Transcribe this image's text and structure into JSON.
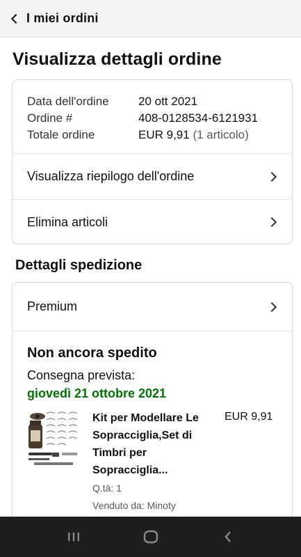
{
  "header": {
    "back_label": "I miei ordini"
  },
  "page_title": "Visualizza dettagli ordine",
  "order_info": {
    "date_label": "Data dell'ordine",
    "date_value": "20 ott 2021",
    "number_label": "Ordine #",
    "number_value": "408-0128534-6121931",
    "total_label": "Totale ordine",
    "total_value": "EUR 9,91",
    "total_items": "(1 articolo)"
  },
  "actions": {
    "summary_label": "Visualizza riepilogo dell'ordine",
    "delete_label": "Elimina articoli"
  },
  "shipping": {
    "section_title": "Dettagli spedizione",
    "method_label": "Premium",
    "status": "Non ancora spedito",
    "delivery_label": "Consegna prevista:",
    "delivery_date": "giovedì 21 ottobre 2021",
    "item": {
      "title": "Kit per Modellare Le Sopracciglia,Set di Timbri per Sopracciglia...",
      "price": "EUR 9,91",
      "quantity": "Q.tà: 1",
      "seller": "Venduto da: Minoty"
    }
  },
  "colors": {
    "delivery_green": "#007600",
    "topbar_bg": "#f3f3f3",
    "navbar_bg": "#1e1e1e"
  }
}
